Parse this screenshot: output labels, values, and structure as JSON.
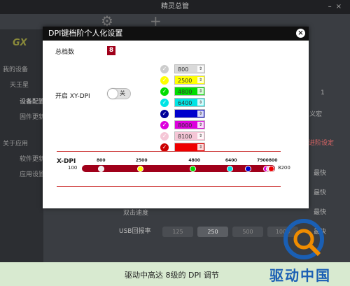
{
  "app": {
    "title": "精灵总管",
    "logo": "GX",
    "sidebar": [
      {
        "label": "我的设备"
      },
      {
        "label": "天王星"
      },
      {
        "label": "设备配置"
      },
      {
        "label": "固件更新"
      },
      {
        "label": "关于应用"
      },
      {
        "label": "软件更新"
      },
      {
        "label": "应用设置"
      }
    ],
    "right": {
      "num": "1",
      "macro": "义宏",
      "advanced": "进阶设定",
      "fast1": "最快",
      "fast2": "最快",
      "fast3": "最快",
      "fast4": "最快"
    },
    "dbl_click_label": "双击速度",
    "usb_rate_label": "USB回报率",
    "usb_rates": [
      "125",
      "250",
      "500",
      "1000"
    ],
    "usb_rate_selected": "250"
  },
  "modal": {
    "title": "DPI键档阶个人化设置",
    "total_label": "总档数",
    "total_value": "8",
    "xy_dpi_label": "开启 XY-DPI",
    "toggle_text": "关",
    "levels": [
      {
        "value": "800",
        "color": "#d9d9d9",
        "checked": false
      },
      {
        "value": "2500",
        "color": "#ffff00",
        "checked": false
      },
      {
        "value": "4800",
        "color": "#00dd00",
        "checked": true
      },
      {
        "value": "6400",
        "color": "#00e5e5",
        "checked": false
      },
      {
        "value": "7200",
        "color": "#0000cc",
        "checked": true
      },
      {
        "value": "8000",
        "color": "#dd00dd",
        "checked": true
      },
      {
        "value": "8100",
        "color": "#f5c6d6",
        "checked": false
      },
      {
        "value": "8200",
        "color": "#ee0000",
        "checked": true
      }
    ],
    "slider": {
      "label": "X-DPI",
      "min": "100",
      "max": "8200",
      "ticks": [
        "800",
        "2500",
        "4800",
        "6400",
        "7200",
        "8000",
        "8100",
        "8200"
      ],
      "tick_joined": "7900800"
    }
  },
  "caption": "驱动中高达 8级的 DPI 调节",
  "brand": "驱动中国"
}
